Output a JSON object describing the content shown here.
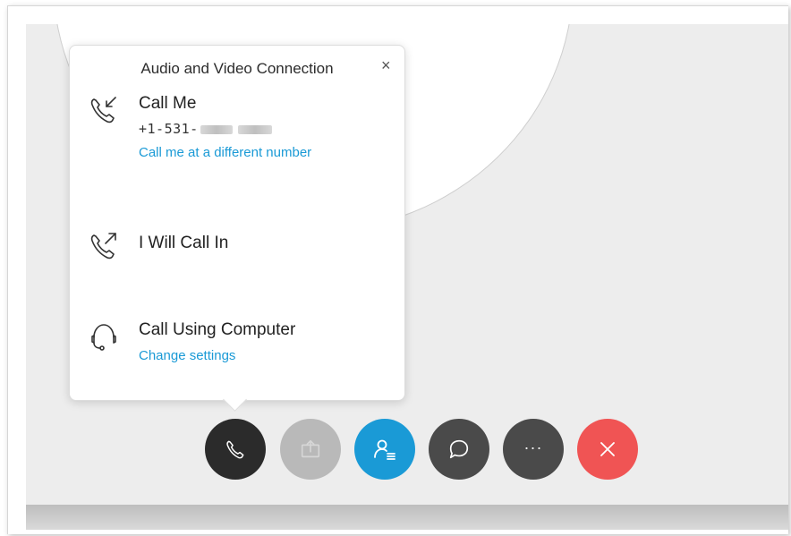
{
  "popover": {
    "title": "Audio and Video Connection",
    "close_label": "×",
    "options": [
      {
        "title": "Call Me",
        "phone_prefix": "+1-531-",
        "link": "Call me at a different number",
        "icon": "phone-incoming-icon"
      },
      {
        "title": "I Will Call In",
        "icon": "phone-outgoing-icon"
      },
      {
        "title": "Call Using Computer",
        "link": "Change settings",
        "icon": "headset-icon"
      }
    ]
  },
  "controls": [
    {
      "name": "audio-button",
      "icon": "phone-icon",
      "color": "#2b2b2b"
    },
    {
      "name": "share-button",
      "icon": "share-icon",
      "color": "#b9b9b9"
    },
    {
      "name": "participants-button",
      "icon": "participants-icon",
      "color": "#1a9ad6"
    },
    {
      "name": "chat-button",
      "icon": "chat-bubble-icon",
      "color": "#4a4a4a"
    },
    {
      "name": "more-button",
      "icon": "more-icon",
      "label": "···",
      "color": "#4a4a4a"
    },
    {
      "name": "leave-button",
      "icon": "close-icon",
      "color": "#f05454"
    }
  ],
  "colors": {
    "accent": "#1a9ad6",
    "stage_bg": "#ededed",
    "leave": "#f05454"
  }
}
